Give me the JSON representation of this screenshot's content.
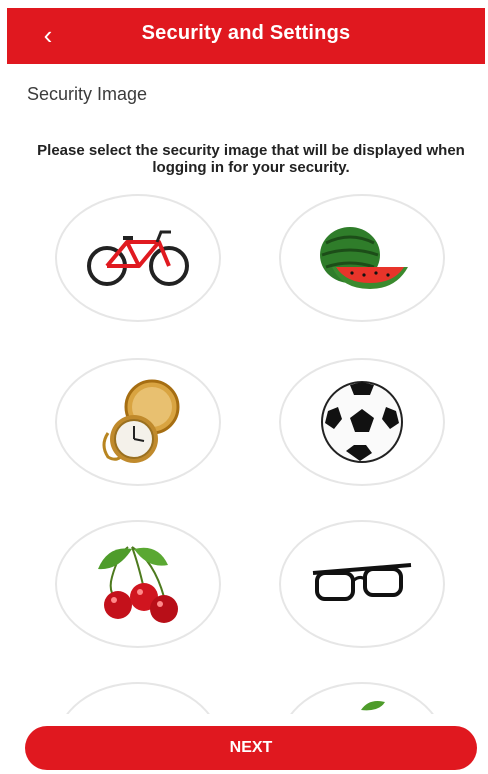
{
  "header": {
    "title": "Security and Settings",
    "back_icon": "chevron-left-icon"
  },
  "section": {
    "title": "Security Image",
    "instructions": "Please select the security image that will be displayed when logging in for your security."
  },
  "images": [
    {
      "name": "bicycle"
    },
    {
      "name": "watermelon"
    },
    {
      "name": "pocket-watch"
    },
    {
      "name": "soccer-ball"
    },
    {
      "name": "cherries"
    },
    {
      "name": "eyeglasses"
    },
    {
      "name": "partial-image-1"
    },
    {
      "name": "partial-image-2"
    }
  ],
  "footer": {
    "next_label": "NEXT"
  },
  "colors": {
    "brand_red": "#e0181f"
  }
}
